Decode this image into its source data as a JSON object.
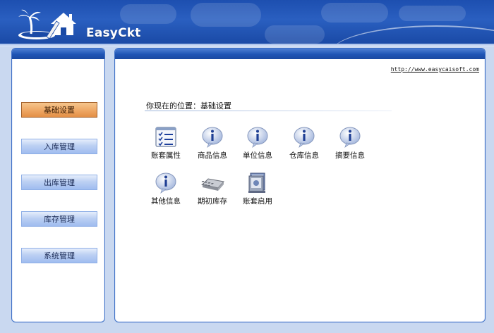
{
  "header": {
    "app_title": "EasyCkt"
  },
  "nav": {
    "items": [
      {
        "label": "基础设置",
        "active": true
      },
      {
        "label": "入库管理",
        "active": false
      },
      {
        "label": "出库管理",
        "active": false
      },
      {
        "label": "库存管理",
        "active": false
      },
      {
        "label": "系统管理",
        "active": false
      }
    ]
  },
  "main": {
    "url": "http://www.easycaisoft.com",
    "breadcrumb": "你现在的位置：基础设置",
    "items": [
      {
        "label": "账套属性",
        "icon": "checklist-icon"
      },
      {
        "label": "商品信息",
        "icon": "info-icon"
      },
      {
        "label": "单位信息",
        "icon": "info-icon"
      },
      {
        "label": "仓库信息",
        "icon": "info-icon"
      },
      {
        "label": "摘要信息",
        "icon": "info-icon"
      },
      {
        "label": "其他信息",
        "icon": "info-icon"
      },
      {
        "label": "期初库存",
        "icon": "keyboard-icon"
      },
      {
        "label": "账套启用",
        "icon": "book-stack-icon"
      }
    ]
  },
  "colors": {
    "banner": "#1d4fb0",
    "panel_border": "#3d6fc6",
    "nav_active": "#eea764",
    "nav_inactive": "#bcd0f3"
  }
}
